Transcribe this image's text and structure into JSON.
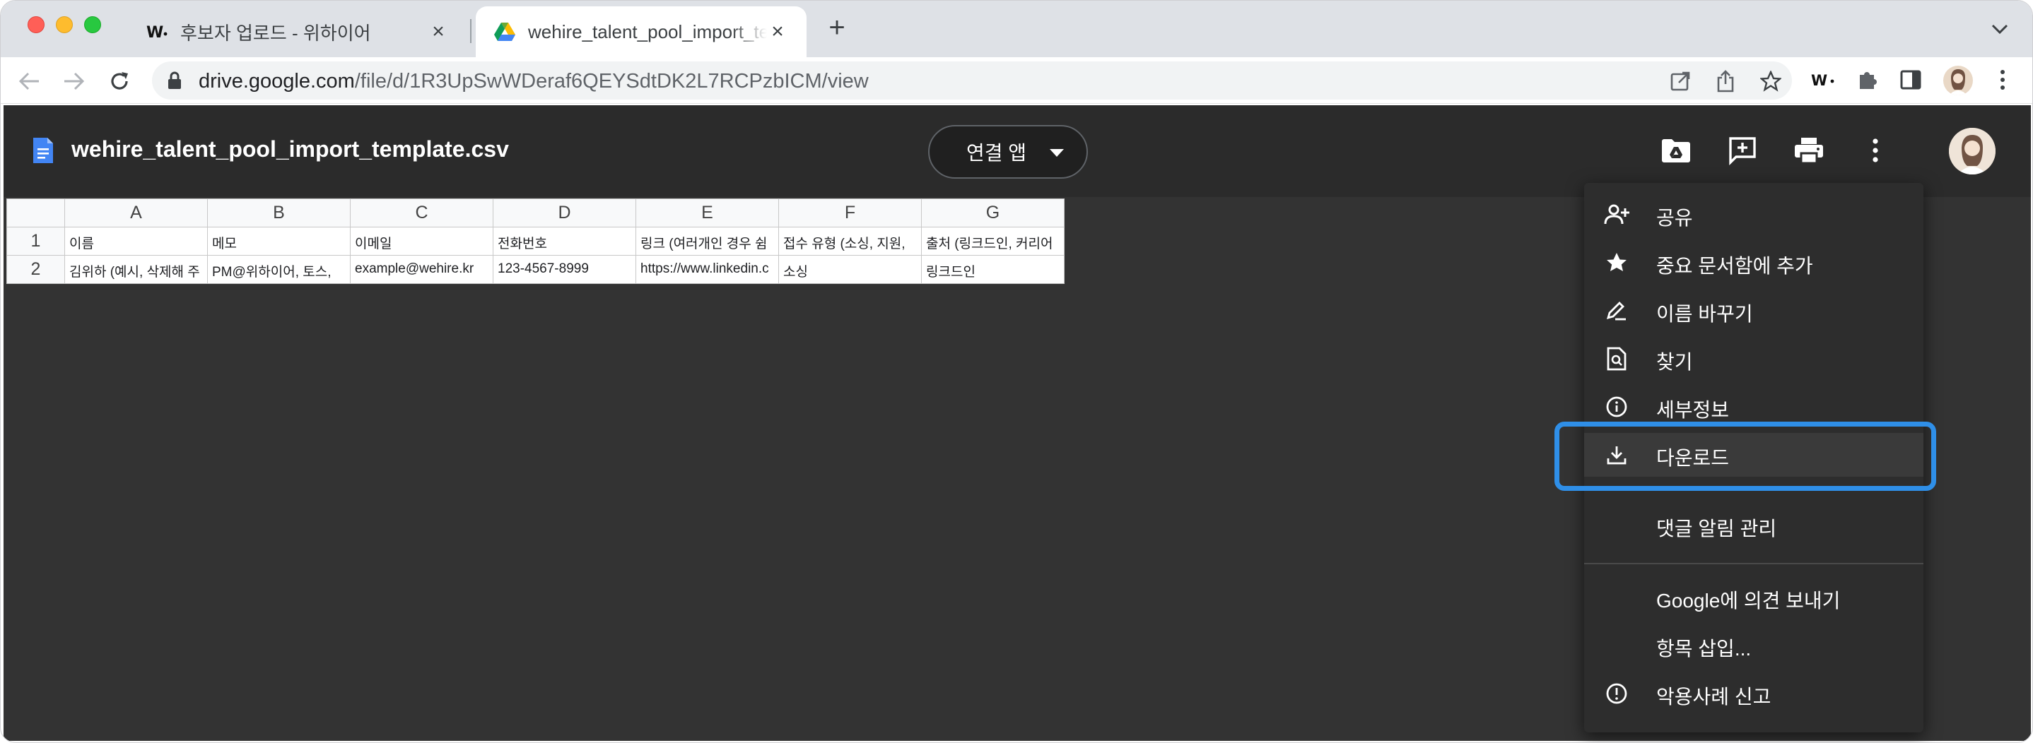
{
  "browser": {
    "tabs": [
      {
        "title": "후보자 업로드 - 위하이어",
        "favicon": "wehire-icon",
        "active": false
      },
      {
        "title": "wehire_talent_pool_import_template.csv",
        "favicon": "google-drive-icon",
        "active": true
      }
    ],
    "url_host": "drive.google.com",
    "url_path": "/file/d/1R3UpSwWDeraf6QEYSdtDK2L7RCPzbICM/view",
    "extension_label": "W·"
  },
  "viewer": {
    "filename": "wehire_talent_pool_import_template.csv",
    "open_with_label": "연결 앱"
  },
  "sheet": {
    "columns": [
      "A",
      "B",
      "C",
      "D",
      "E",
      "F",
      "G"
    ],
    "rows": [
      {
        "num": "1",
        "cells": [
          "이름",
          "메모",
          "이메일",
          "전화번호",
          "링크 (여러개인 경우 쉼",
          "접수 유형 (소싱, 지원,",
          "출처 (링크드인, 커리어"
        ]
      },
      {
        "num": "2",
        "cells": [
          "김위하 (예시, 삭제해 주",
          "PM@위하이어, 토스,",
          "example@wehire.kr",
          "123-4567-8999",
          "https://www.linkedin.c",
          "소싱",
          "링크드인"
        ]
      }
    ]
  },
  "menu": {
    "items": [
      {
        "label": "공유",
        "icon": "add-person-icon"
      },
      {
        "label": "중요 문서함에 추가",
        "icon": "star-icon"
      },
      {
        "label": "이름 바꾸기",
        "icon": "rename-icon"
      },
      {
        "label": "찾기",
        "icon": "find-in-doc-icon"
      },
      {
        "label": "세부정보",
        "icon": "info-icon"
      },
      {
        "label": "다운로드",
        "icon": "download-icon"
      },
      {
        "label": "댓글 알림 관리",
        "icon": ""
      },
      {
        "label": "Google에 의견 보내기",
        "icon": ""
      },
      {
        "label": "항목 삽입...",
        "icon": ""
      },
      {
        "label": "악용사례 신고",
        "icon": "report-icon"
      }
    ]
  },
  "colors": {
    "accent": "#2f8fe8",
    "viewer_bg": "#333333",
    "menu_bg": "#2d2d2d"
  }
}
